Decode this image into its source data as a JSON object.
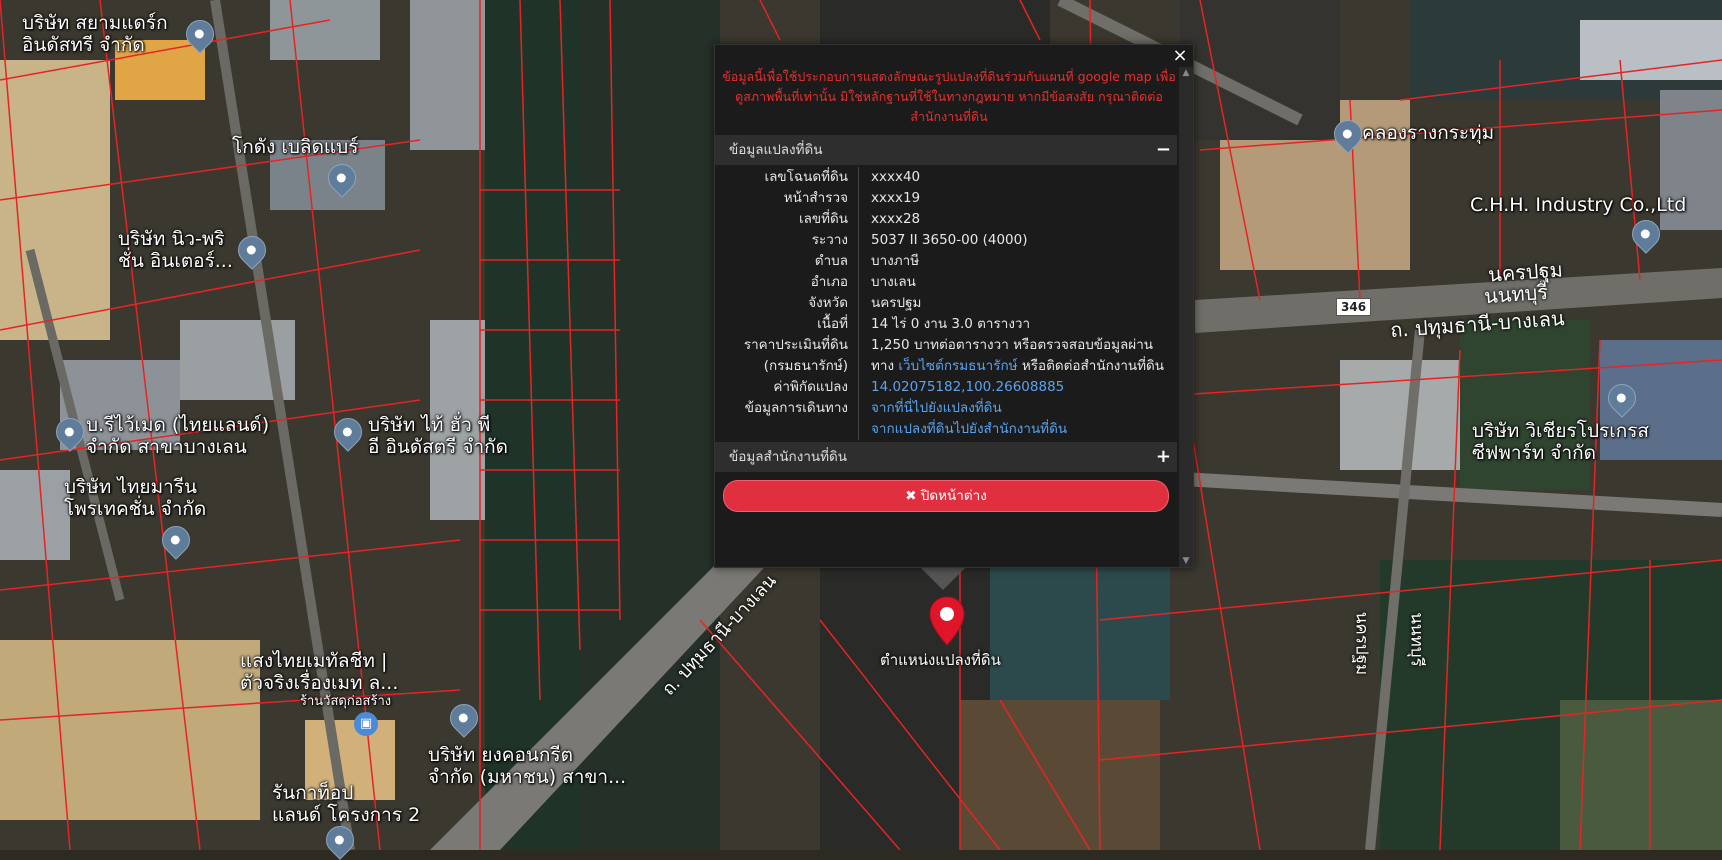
{
  "map": {
    "places": [
      {
        "id": "siam",
        "lines": [
          "บริษัท สยามแดร์ก",
          "อินดัสทรี จำกัด"
        ]
      },
      {
        "id": "godang",
        "lines": [
          "โกดัง เบลิดแบร์"
        ]
      },
      {
        "id": "newpro",
        "lines": [
          "บริษัท นิว-พริ",
          "ชั่น อินเตอร์..."
        ]
      },
      {
        "id": "rthai",
        "lines": [
          "บ.รีไว้เมด (ไทยแลนด์)",
          "จำกัด สาขาบางเลน"
        ]
      },
      {
        "id": "taihua",
        "lines": [
          "บริษัท ไท้ ฮั่ว พี",
          "อี อินดัสตรี จำกัด"
        ]
      },
      {
        "id": "thaimarine",
        "lines": [
          "บริษัท ไทยมารีน",
          "โพรเทคชั่น จำกัด"
        ]
      },
      {
        "id": "sangthai",
        "lines": [
          "แสงไทยเมทัลชีท |",
          "ตัวจริงเรื่องเมท ล..."
        ]
      },
      {
        "id": "sangthai_sub",
        "lines": [
          "ร้านวัสดุก่อสร้าง"
        ]
      },
      {
        "id": "yong",
        "lines": [
          "บริษัท ยงคอนกรีต",
          "จำกัด (มหาชน) สาขา..."
        ]
      },
      {
        "id": "runtop",
        "lines": [
          "รันกาท็อป",
          "แลนด์ โครงการ 2"
        ]
      },
      {
        "id": "khlong",
        "lines": [
          "คลองรางกระทุ่ม"
        ]
      },
      {
        "id": "chh",
        "lines": [
          "C.H.H. Industry Co.,Ltd"
        ]
      },
      {
        "id": "vichien",
        "lines": [
          "บริษัท วิเชียรโปรเกรส",
          "ซีฟพาร์ท จำกัด"
        ]
      }
    ],
    "roads": {
      "nakhon_pathom_top": "นครปฐม",
      "nonthaburi_top": "นนทบุรี",
      "pathum_banglen_right": "ถ. ปทุมธานี-บางเลน",
      "pathum_banglen_left": "ถ. ปทุมธานี-บางเลน",
      "nakhon_pathom_v": "นครปฐม",
      "nonthaburi_v": "นนทบุรี",
      "route_shield": "346"
    },
    "marker_label": "ตำแหน่งแปลงที่ดิน"
  },
  "dialog": {
    "disclaimer": "ข้อมูลนี้เพื่อใช้ประกอบการแสดงลักษณะรูปแปลงที่ดินร่วมกับแผนที่ google map เพื่อดูสภาพพื้นที่เท่านั้น มิใช่หลักฐานที่ใช้ในทางกฎหมาย หากมีข้อสงสัย กรุณาติดต่อสำนักงานที่ดิน",
    "close_x": "×",
    "section1": {
      "title": "ข้อมูลแปลงที่ดิน",
      "toggle": "−"
    },
    "rows": [
      {
        "label": "เลขโฉนดที่ดิน",
        "value": "xxxx40"
      },
      {
        "label": "หน้าสำรวจ",
        "value": "xxxx19"
      },
      {
        "label": "เลขที่ดิน",
        "value": "xxxx28"
      },
      {
        "label": "ระวาง",
        "value": "5037 II 3650-00 (4000)"
      },
      {
        "label": "ตำบล",
        "value": "บางภาษี"
      },
      {
        "label": "อำเภอ",
        "value": "บางเลน"
      },
      {
        "label": "จังหวัด",
        "value": "นครปฐม"
      },
      {
        "label": "เนื้อที่",
        "value": "14 ไร่ 0 งาน 3.0 ตารางวา"
      },
      {
        "label": "ราคาประเมินที่ดิน",
        "value": "1,250 บาทต่อตารางวา หรือตรวจสอบข้อมูลผ่าน"
      }
    ],
    "row_treasury": {
      "label": "(กรมธนารักษ์)",
      "prefix": "ทาง ",
      "link": "เว็บไซต์กรมธนารักษ์",
      "suffix": " หรือติดต่อสำนักงานที่ดิน"
    },
    "row_coord": {
      "label": "ค่าพิกัดแปลง",
      "link": "14.02075182,100.26608885"
    },
    "row_travel": {
      "label": "ข้อมูลการเดินทาง",
      "link1": "จากที่นี่ไปยังแปลงที่ดิน",
      "link2": "จากแปลงที่ดินไปยังสำนักงานที่ดิน"
    },
    "section2": {
      "title": "ข้อมูลสำนักงานที่ดิน",
      "toggle": "+"
    },
    "close_button": "✖ ปิดหน้าต่าง"
  }
}
